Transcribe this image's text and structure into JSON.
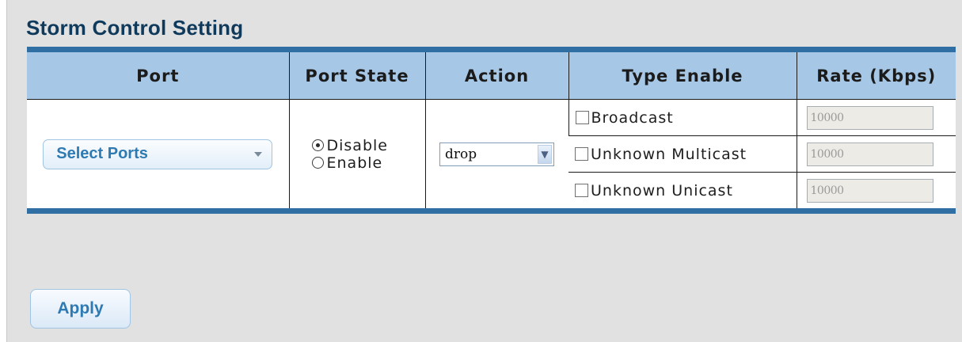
{
  "section_title": "Storm Control Setting",
  "table": {
    "headers": {
      "port": "Port",
      "port_state": "Port State",
      "action": "Action",
      "type_enable": "Type Enable",
      "rate": "Rate (Kbps)"
    },
    "port_select": {
      "label": "Select Ports",
      "icon": "caret-down"
    },
    "port_state": {
      "options": [
        {
          "label": "Disable",
          "checked": true
        },
        {
          "label": "Enable",
          "checked": false
        }
      ]
    },
    "action": {
      "selected": "drop",
      "icon": "chevron-down"
    },
    "types": [
      {
        "label": "Broadcast",
        "checked": false,
        "rate": "10000"
      },
      {
        "label": "Unknown Multicast",
        "checked": false,
        "rate": "10000"
      },
      {
        "label": "Unknown Unicast",
        "checked": false,
        "rate": "10000"
      }
    ]
  },
  "apply_button": {
    "label": "Apply"
  },
  "colors": {
    "title": "#0f3a5c",
    "header_bg": "#a7c7e6",
    "table_border": "#2f6fa3",
    "panel_bg": "#e1e1e1",
    "button_text": "#2e7ab3"
  }
}
